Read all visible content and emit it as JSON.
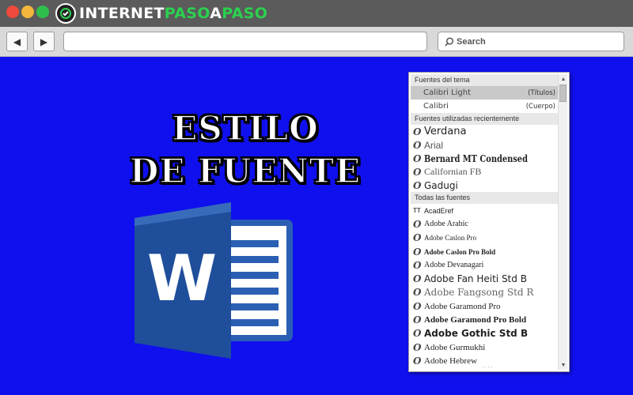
{
  "browser": {
    "brand": {
      "part1": "INTERNET",
      "part2": "PASO",
      "part3": "A",
      "part4": "PASO"
    },
    "nav": {
      "back_icon": "◀",
      "forward_icon": "▶"
    },
    "url": "",
    "search_placeholder": "Search"
  },
  "headline": {
    "line1": "ESTILO",
    "line2": "DE FUENTE"
  },
  "word_logo": {
    "letter": "W",
    "colors": {
      "dark": "#1f4e9b",
      "mid": "#2b5fb3",
      "light": "#4c85d6",
      "page": "#ffffff"
    }
  },
  "font_menu": {
    "theme_header": "Fuentes del tema",
    "theme_fonts": [
      {
        "name": "Calibri Light",
        "tag": "(Títulos)",
        "highlighted": true
      },
      {
        "name": "Calibri",
        "tag": "(Cuerpo)",
        "highlighted": false
      }
    ],
    "recent_header": "Fuentes utilizadas recientemente",
    "recent_fonts": [
      {
        "name": "Verdana",
        "size": 13,
        "family": "\"DejaVu Sans\", sans-serif",
        "weight": "normal",
        "style": "normal"
      },
      {
        "name": "Arial",
        "size": 12,
        "family": "\"Liberation Sans\", sans-serif",
        "weight": "normal",
        "style": "normal",
        "color": "#555"
      },
      {
        "name": "Bernard MT Condensed",
        "size": 12,
        "family": "\"DejaVu Serif\", serif",
        "weight": "bold",
        "style": "normal",
        "condensed": true
      },
      {
        "name": "Californian FB",
        "size": 12,
        "family": "\"Liberation Serif\", serif",
        "weight": "normal",
        "style": "normal",
        "color": "#555"
      },
      {
        "name": "Gadugi",
        "size": 12,
        "family": "\"DejaVu Sans\", sans-serif",
        "weight": "normal",
        "style": "normal"
      }
    ],
    "all_header": "Todas las fuentes",
    "all_fonts": [
      {
        "name": "AcadEref",
        "icon": "tt",
        "size": 9,
        "family": "\"Liberation Sans\", sans-serif",
        "weight": "normal",
        "style": "normal"
      },
      {
        "name": "Adobe Arabic",
        "size": 10,
        "family": "\"Liberation Serif\", serif",
        "weight": "normal",
        "style": "normal"
      },
      {
        "name": "Adobe Caslon Pro",
        "size": 9,
        "family": "\"Liberation Serif\", serif",
        "weight": "normal",
        "style": "normal"
      },
      {
        "name": "Adobe Caslon Pro Bold",
        "size": 9,
        "family": "\"Liberation Serif\", serif",
        "weight": "bold",
        "style": "normal"
      },
      {
        "name": "Adobe Devanagari",
        "size": 10,
        "family": "\"Liberation Serif\", serif",
        "weight": "normal",
        "style": "normal"
      },
      {
        "name": "Adobe Fan Heiti Std B",
        "size": 12,
        "family": "\"DejaVu Sans\", sans-serif",
        "weight": "normal",
        "style": "normal"
      },
      {
        "name": "Adobe Fangsong Std R",
        "size": 12,
        "family": "\"DejaVu Serif\", serif",
        "weight": "normal",
        "style": "normal",
        "color": "#666"
      },
      {
        "name": "Adobe Garamond Pro",
        "size": 11,
        "family": "\"Liberation Serif\", serif",
        "weight": "normal",
        "style": "normal"
      },
      {
        "name": "Adobe Garamond Pro Bold",
        "size": 11,
        "family": "\"Liberation Serif\", serif",
        "weight": "bold",
        "style": "normal"
      },
      {
        "name": "Adobe Gothic Std B",
        "size": 12,
        "family": "\"DejaVu Sans\", sans-serif",
        "weight": "bold",
        "style": "normal"
      },
      {
        "name": "Adobe Gurmukhi",
        "size": 11,
        "family": "\"Liberation Serif\", serif",
        "weight": "normal",
        "style": "normal"
      },
      {
        "name": "Adobe Hebrew",
        "size": 11,
        "family": "\"Liberation Serif\", serif",
        "weight": "normal",
        "style": "normal"
      }
    ]
  }
}
